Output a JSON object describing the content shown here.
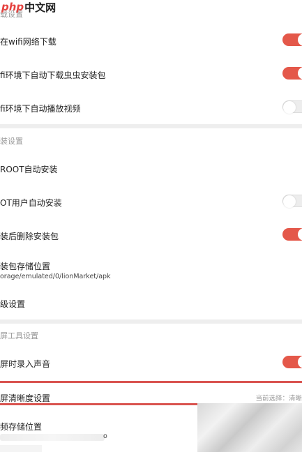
{
  "watermark": {
    "brand_latin": "php",
    "brand_cn": "中文网"
  },
  "sections": {
    "download": {
      "header": "载设置",
      "wifi_only_download": "在wifi网络下载",
      "auto_download_package": "fi环境下自动下载虫虫安装包",
      "auto_play_video": "fi环境下自动播放视频"
    },
    "install": {
      "header": "装设置",
      "root_auto_install": "ROOT自动安装",
      "non_root_auto_install": "OT用户自动安装",
      "delete_after_install": "装后删除安装包",
      "storage_location_label": "装包存储位置",
      "storage_location_path": "orage/emulated/0/lionMarket/apk",
      "more_settings": "级设置"
    },
    "recorder": {
      "header": "屏工具设置",
      "record_audio": "屏时录入声音",
      "clarity_label": "屏清晰度设置",
      "clarity_current": "当前选择：清晰",
      "video_storage_label": "频存储位置",
      "video_storage_suffix": "o"
    }
  },
  "toggles": {
    "wifi_only_download": true,
    "auto_download_package": true,
    "auto_play_video": false,
    "non_root_auto_install": false,
    "delete_after_install": true,
    "record_audio": true
  },
  "colors": {
    "accent": "#e4584a",
    "divider": "#eeeeee",
    "header_text": "#999999"
  }
}
